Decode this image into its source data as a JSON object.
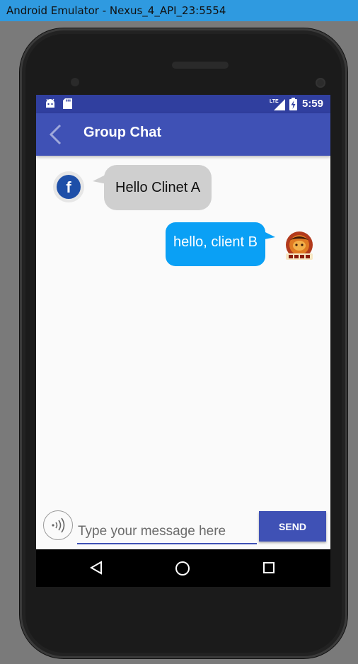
{
  "window": {
    "title": "Android Emulator - Nexus_4_API_23:5554"
  },
  "statusbar": {
    "time": "5:59",
    "left_icons": [
      "android-debug-icon",
      "sd-card-icon"
    ],
    "right_icons": [
      "lte-signal-icon",
      "battery-charging-icon"
    ],
    "network_label": "LTE"
  },
  "appbar": {
    "title": "Group Chat",
    "back_icon": "chevron-left-icon"
  },
  "messages": [
    {
      "side": "left",
      "text": "Hello Clinet A",
      "avatar": "facebook-icon"
    },
    {
      "side": "right",
      "text": "hello, client B",
      "avatar": "app-logo"
    }
  ],
  "composer": {
    "placeholder": "Type your message here",
    "value": "",
    "send_label": "SEND",
    "voice_icon": "voice-icon"
  },
  "navbar": {
    "icons": [
      "back-triangle-icon",
      "home-circle-icon",
      "recents-square-icon"
    ]
  },
  "colors": {
    "primary": "#3f51b5",
    "primary_dark": "#303f9f",
    "bubble_left": "#cfcfcf",
    "bubble_right": "#0aa0f5",
    "window_titlebar": "#2f9ae0"
  }
}
